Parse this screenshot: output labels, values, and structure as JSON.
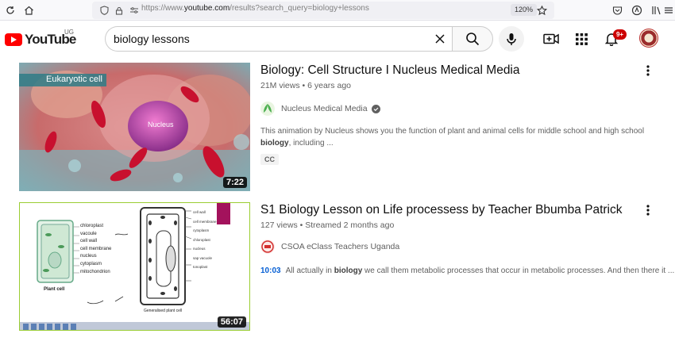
{
  "browser": {
    "url_prefix": "https://www.",
    "url_domain": "youtube.com",
    "url_rest": "/results?search_query=biology+lessons",
    "zoom": "120%"
  },
  "header": {
    "logo_text": "YouTube",
    "country_code": "UG",
    "search_value": "biology lessons",
    "notification_count": "9+"
  },
  "results": [
    {
      "title": "Biology: Cell Structure I Nucleus Medical Media",
      "views": "21M views",
      "age": "6 years ago",
      "channel": "Nucleus Medical Media",
      "verified": true,
      "description_pre": "This animation by Nucleus shows you the function of plant and animal cells for middle school and high school ",
      "description_bold": "biology",
      "description_post": ", including ...",
      "badge": "CC",
      "duration": "7:22",
      "thumb_label": "Eukaryotic cell",
      "thumb_inner_label": "Nucleus"
    },
    {
      "title": "S1 Biology Lesson on Life processess by Teacher Bbumba Patrick",
      "views": "127 views",
      "age": "Streamed 2 months ago",
      "channel": "CSOA eClass Teachers Uganda",
      "timestamp": "10:03",
      "description_pre": "All actually in ",
      "description_bold": "biology",
      "description_post": " we call them metabolic processes that occur in metabolic processes. And then there it ...",
      "duration": "56:07",
      "thumb_labels": [
        "chloroplast",
        "vacoule",
        "cell wall",
        "cell membrane",
        "nucleus",
        "cytoplasm",
        "mitochondrion"
      ],
      "thumb_caption": "Plant cell",
      "thumb_caption2": "Generalised plant cell",
      "thumb_right_labels": [
        "cell wall",
        "cell membrane",
        "cytoplasm",
        "chloroplast",
        "nucleus",
        "sap vacuole",
        "tonoplast"
      ]
    }
  ]
}
